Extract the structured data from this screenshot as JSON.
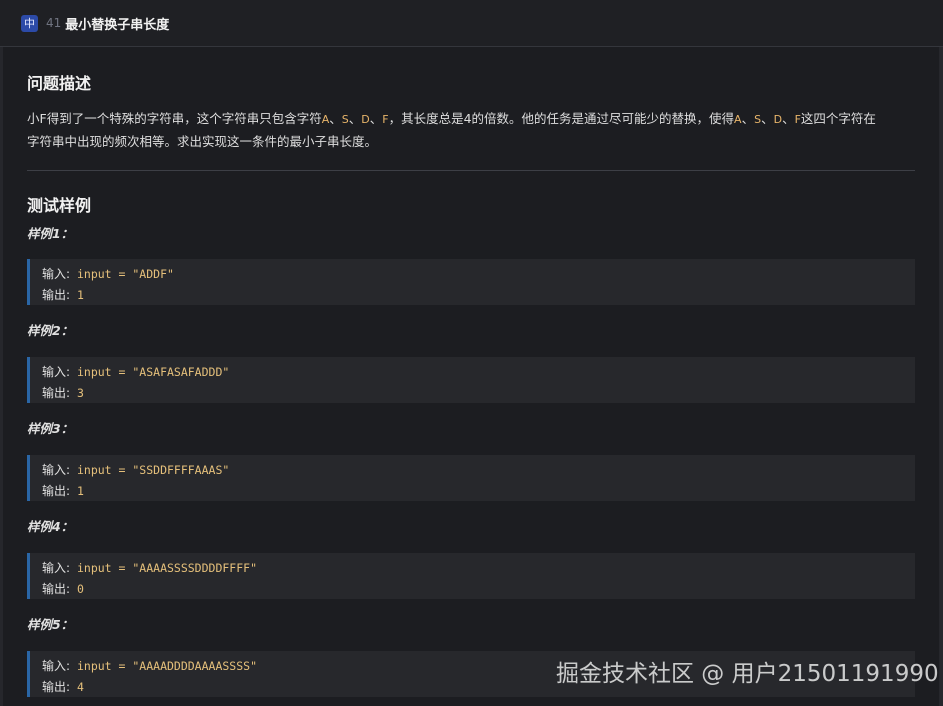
{
  "header": {
    "lang_badge": "中",
    "problem_number": "41",
    "title": "最小替换子串长度"
  },
  "section_description": {
    "heading": "问题描述",
    "line1_parts": [
      "小F得到了一个特殊的字符串，这个字符串只包含字符",
      "A",
      "、",
      "S",
      "、",
      "D",
      "、",
      "F",
      "，其长度总是4的倍数。他的任务是通过尽可能少的替换，使得",
      "A",
      "、",
      "S",
      "、",
      "D",
      "、",
      "F",
      "这四个字符在"
    ],
    "line2": "字符串中出现的频次相等。求出实现这一条件的最小子串长度。"
  },
  "section_samples": {
    "heading": "测试样例",
    "input_label": "输入:",
    "output_label": "输出:",
    "samples": [
      {
        "label": "样例1：",
        "input": "input = \"ADDF\"",
        "output": "1"
      },
      {
        "label": "样例2：",
        "input": "input = \"ASAFASAFADDD\"",
        "output": "3"
      },
      {
        "label": "样例3：",
        "input": "input = \"SSDDFFFFAAAS\"",
        "output": "1"
      },
      {
        "label": "样例4：",
        "input": "input = \"AAAASSSSDDDDFFFF\"",
        "output": "0"
      },
      {
        "label": "样例5：",
        "input": "input = \"AAAADDDDAAAASSSS\"",
        "output": "4"
      }
    ]
  },
  "watermark": "掘金技术社区 @ 用户21501191990",
  "colors": {
    "background": "#1c1d21",
    "highlight": "#e8b56a",
    "code_value": "#e5c07b",
    "code_border": "#2a66a6",
    "badge": "#2c4aa7"
  }
}
